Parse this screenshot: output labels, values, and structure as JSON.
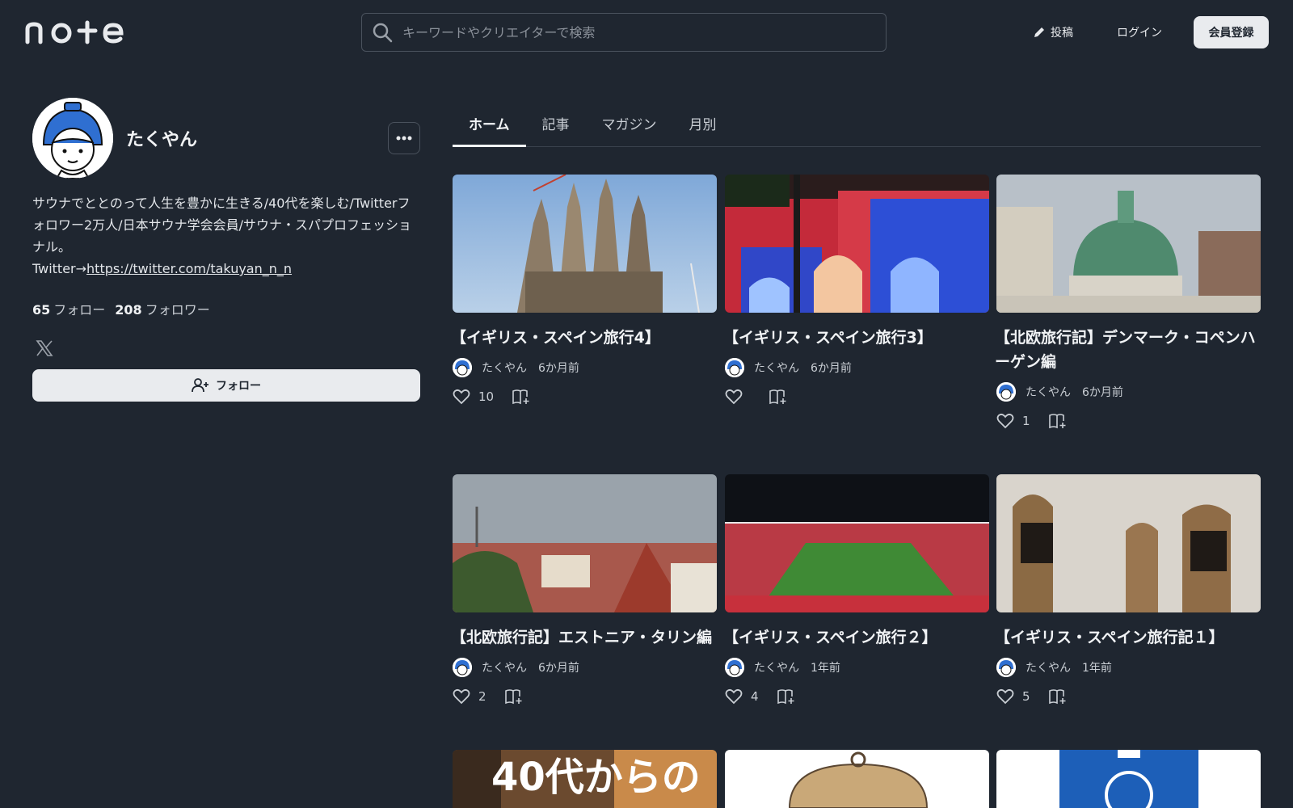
{
  "header": {
    "logo_text": "note",
    "search_placeholder": "キーワードやクリエイターで検索",
    "post_label": "投稿",
    "login_label": "ログイン",
    "signup_label": "会員登録"
  },
  "profile": {
    "name": "たくやん",
    "bio_text": "サウナでととのって人生を豊かに生きる/40代を楽しむ/Twitterフォロワー2万人/日本サウナ学会会員/サウナ・スパプロフェッショナル。",
    "bio_link_prefix": "Twitter→",
    "bio_link": "https://twitter.com/takuyan_n_n",
    "following_count": "65",
    "following_label": "フォロー",
    "followers_count": "208",
    "followers_label": "フォロワー",
    "follow_button": "フォロー"
  },
  "tabs": [
    {
      "label": "ホーム",
      "active": true
    },
    {
      "label": "記事",
      "active": false
    },
    {
      "label": "マガジン",
      "active": false
    },
    {
      "label": "月別",
      "active": false
    }
  ],
  "articles": [
    {
      "title": "【イギリス・スペイン旅行4】",
      "author": "たくやん",
      "time": "6か月前",
      "likes": "10"
    },
    {
      "title": "【イギリス・スペイン旅行3】",
      "author": "たくやん",
      "time": "6か月前",
      "likes": ""
    },
    {
      "title": "【北欧旅行記】デンマーク・コペンハーゲン編",
      "author": "たくやん",
      "time": "6か月前",
      "likes": "1"
    },
    {
      "title": "【北欧旅行記】エストニア・タリン編",
      "author": "たくやん",
      "time": "6か月前",
      "likes": "2"
    },
    {
      "title": "【イギリス・スペイン旅行２】",
      "author": "たくやん",
      "time": "1年前",
      "likes": "4"
    },
    {
      "title": "【イギリス・スペイン旅行記１】",
      "author": "たくやん",
      "time": "1年前",
      "likes": "5"
    }
  ],
  "partial_cards": [
    {
      "thumb_text": "40代からの"
    }
  ],
  "colors": {
    "background": "#1f2630",
    "text": "#e8eaed",
    "button_light": "#e9ebee"
  }
}
